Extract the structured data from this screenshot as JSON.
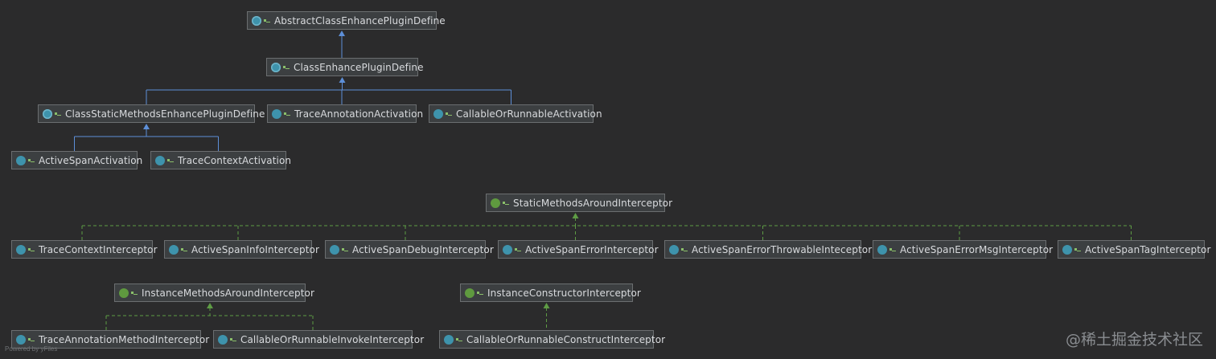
{
  "nodes": [
    {
      "id": "n1",
      "label": "AbstractClassEnhancePluginDefine",
      "kind": "abstract"
    },
    {
      "id": "n2",
      "label": "ClassEnhancePluginDefine",
      "kind": "abstract"
    },
    {
      "id": "n3",
      "label": "ClassStaticMethodsEnhancePluginDefine",
      "kind": "abstract"
    },
    {
      "id": "n4",
      "label": "TraceAnnotationActivation",
      "kind": "class"
    },
    {
      "id": "n5",
      "label": "CallableOrRunnableActivation",
      "kind": "class"
    },
    {
      "id": "n6",
      "label": "ActiveSpanActivation",
      "kind": "class"
    },
    {
      "id": "n7",
      "label": "TraceContextActivation",
      "kind": "class"
    },
    {
      "id": "n8",
      "label": "StaticMethodsAroundInterceptor",
      "kind": "interface"
    },
    {
      "id": "n9",
      "label": "TraceContextInterceptor",
      "kind": "class"
    },
    {
      "id": "n10",
      "label": "ActiveSpanInfoInterceptor",
      "kind": "class"
    },
    {
      "id": "n11",
      "label": "ActiveSpanDebugInterceptor",
      "kind": "class"
    },
    {
      "id": "n12",
      "label": "ActiveSpanErrorInterceptor",
      "kind": "class"
    },
    {
      "id": "n13",
      "label": "ActiveSpanErrorThrowableInteceptor",
      "kind": "class"
    },
    {
      "id": "n14",
      "label": "ActiveSpanErrorMsgInterceptor",
      "kind": "class"
    },
    {
      "id": "n15",
      "label": "ActiveSpanTagInterceptor",
      "kind": "class"
    },
    {
      "id": "n16",
      "label": "InstanceMethodsAroundInterceptor",
      "kind": "interface"
    },
    {
      "id": "n17",
      "label": "TraceAnnotationMethodInterceptor",
      "kind": "class"
    },
    {
      "id": "n18",
      "label": "CallableOrRunnableInvokeInterceptor",
      "kind": "class"
    },
    {
      "id": "n19",
      "label": "InstanceConstructorInterceptor",
      "kind": "interface"
    },
    {
      "id": "n20",
      "label": "CallableOrRunnableConstructInterceptor",
      "kind": "class"
    }
  ],
  "edges": [
    {
      "from": "n2",
      "to": "n1",
      "type": "extends"
    },
    {
      "from": "n3",
      "to": "n2",
      "type": "extends"
    },
    {
      "from": "n4",
      "to": "n2",
      "type": "extends"
    },
    {
      "from": "n5",
      "to": "n2",
      "type": "extends"
    },
    {
      "from": "n6",
      "to": "n3",
      "type": "extends"
    },
    {
      "from": "n7",
      "to": "n3",
      "type": "extends"
    },
    {
      "from": "n9",
      "to": "n8",
      "type": "implements"
    },
    {
      "from": "n10",
      "to": "n8",
      "type": "implements"
    },
    {
      "from": "n11",
      "to": "n8",
      "type": "implements"
    },
    {
      "from": "n12",
      "to": "n8",
      "type": "implements"
    },
    {
      "from": "n13",
      "to": "n8",
      "type": "implements"
    },
    {
      "from": "n14",
      "to": "n8",
      "type": "implements"
    },
    {
      "from": "n15",
      "to": "n8",
      "type": "implements"
    },
    {
      "from": "n17",
      "to": "n16",
      "type": "implements"
    },
    {
      "from": "n18",
      "to": "n16",
      "type": "implements"
    },
    {
      "from": "n20",
      "to": "n19",
      "type": "implements"
    }
  ],
  "icons": {
    "class": "c",
    "abstract": "a",
    "interface": "i"
  },
  "colors": {
    "extends": "#5d8fd8",
    "implements": "#5e9c45",
    "background": "#2b2b2c"
  },
  "footer": "Powered by yFiles",
  "watermark": "@稀土掘金技术社区"
}
